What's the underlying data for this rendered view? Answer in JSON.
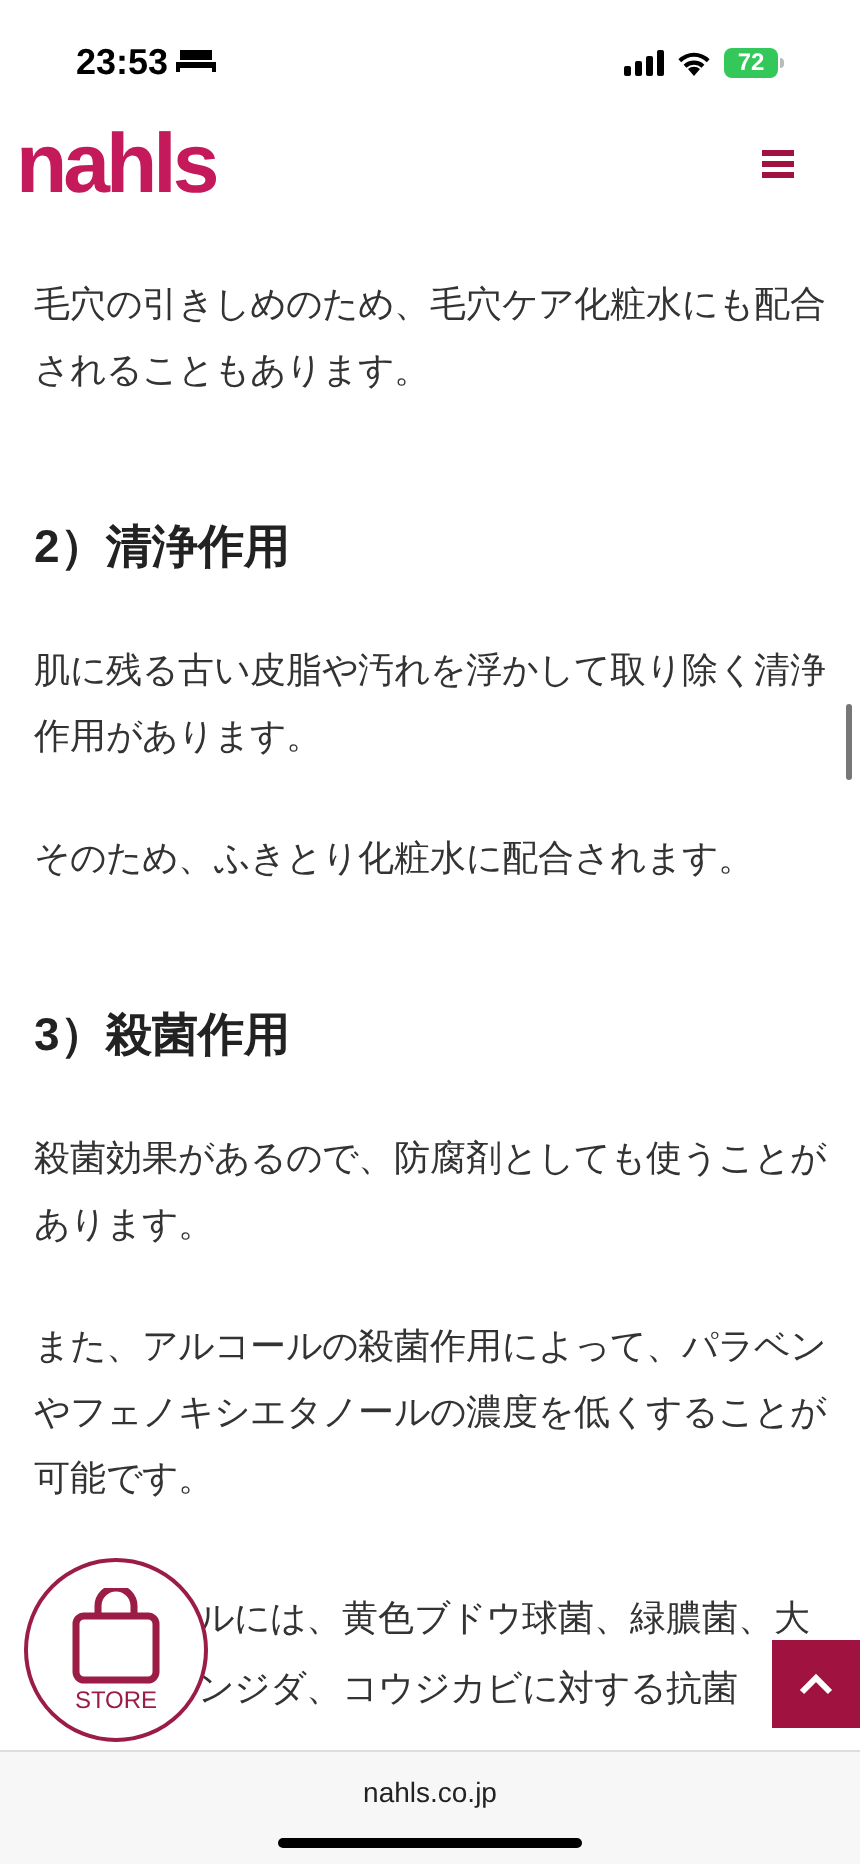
{
  "status_bar": {
    "time": "23:53",
    "battery": "72"
  },
  "header": {
    "logo": "nahls"
  },
  "article": [
    {
      "kind": "paragraph",
      "text": "毛穴の引きしめのため、毛穴ケア化粧水にも配合されることもあります。"
    },
    {
      "kind": "heading",
      "text": "2）清浄作用"
    },
    {
      "kind": "paragraph",
      "text": "肌に残る古い皮脂や汚れを浮かして取り除く清浄作用があります。"
    },
    {
      "kind": "paragraph",
      "text": "そのため、ふきとり化粧水に配合されます。"
    },
    {
      "kind": "heading",
      "text": "3）殺菌作用"
    },
    {
      "kind": "paragraph",
      "text": "殺菌効果があるので、防腐剤としても使うことがあります。"
    },
    {
      "kind": "paragraph",
      "text": "また、アルコールの殺菌作用によって、パラベンやフェノキシエタノールの濃度を低くすることが可能です。"
    },
    {
      "kind": "partial",
      "lines": [
        "ルには、黄色ブドウ球菌、緑膿菌、大",
        "ンジダ、コウジカビに対する抗菌"
      ]
    }
  ],
  "store_button": {
    "label": "STORE"
  },
  "address_bar": {
    "url": "nahls.co.jp"
  }
}
